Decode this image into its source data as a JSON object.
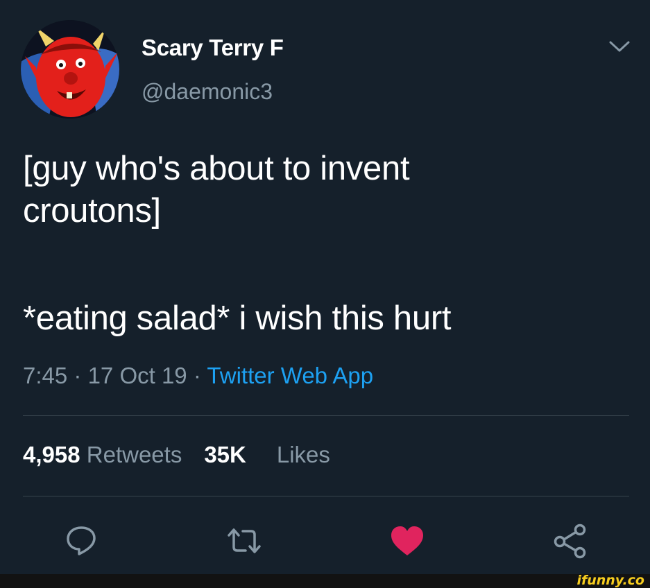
{
  "user": {
    "display_name": "Scary Terry F",
    "handle": "@daemonic3"
  },
  "tweet": {
    "lines": [
      "[guy who's about to invent",
      "croutons]",
      "*eating salad* i wish this hurt"
    ],
    "time": "7:45",
    "separator": "·",
    "date": "17 Oct 19",
    "source": "Twitter Web App"
  },
  "stats": {
    "retweets_count": "4,958",
    "retweets_label": "Retweets",
    "likes_count": "35K",
    "likes_label": "Likes"
  },
  "actions": {
    "reply_icon": "reply-bubble-icon",
    "retweet_icon": "retweet-arrows-icon",
    "like_icon": "heart-filled-icon",
    "share_icon": "share-nodes-icon"
  },
  "colors": {
    "background": "#15202b",
    "text": "#ffffff",
    "muted": "#8899a6",
    "link": "#1da1f2",
    "like": "#e0245e",
    "divider": "#38444d"
  },
  "watermark": "ifunny.co"
}
